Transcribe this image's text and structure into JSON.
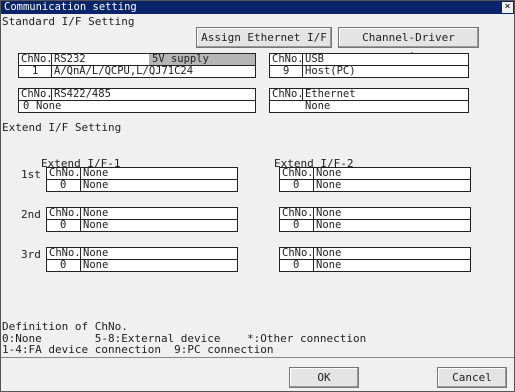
{
  "window": {
    "title": "Communication setting",
    "close_glyph": "×"
  },
  "standard": {
    "heading": "Standard I/F Setting"
  },
  "buttons": {
    "assign_ethernet": "Assign Ethernet I/F",
    "channel_driver": "Channel-Driver assign",
    "ok": "OK",
    "cancel": "Cancel"
  },
  "rs232": {
    "ch_header": "ChNo.",
    "name": "RS232",
    "supply": "5V supply",
    "ch": "1",
    "value": "A/QnA/L/QCPU,L/QJ71C24"
  },
  "usb": {
    "ch_header": "ChNo.",
    "name": "USB",
    "ch": "9",
    "value": "Host(PC)"
  },
  "rs422": {
    "ch_header": "ChNo.",
    "name": "RS422/485",
    "ch": "0",
    "value": "None"
  },
  "ethernet": {
    "ch_header": "ChNo.",
    "name": "Ethernet",
    "value": "None"
  },
  "extend": {
    "heading": "Extend I/F Setting",
    "col1": "Extend I/F-1",
    "col2": "Extend I/F-2",
    "rows": [
      {
        "label": "1st",
        "l_hdr": "ChNo.",
        "l_name": "None",
        "l_ch": "0",
        "l_val": "None",
        "r_hdr": "ChNo.",
        "r_name": "None",
        "r_ch": "0",
        "r_val": "None"
      },
      {
        "label": "2nd",
        "l_hdr": "ChNo.",
        "l_name": "None",
        "l_ch": "0",
        "l_val": "None",
        "r_hdr": "ChNo.",
        "r_name": "None",
        "r_ch": "0",
        "r_val": "None"
      },
      {
        "label": "3rd",
        "l_hdr": "ChNo.",
        "l_name": "None",
        "l_ch": "0",
        "l_val": "None",
        "r_hdr": "ChNo.",
        "r_name": "None",
        "r_ch": "0",
        "r_val": "None"
      }
    ]
  },
  "definition": {
    "title": "Definition of ChNo.",
    "line1": "0:None        5-8:External device    *:Other connection",
    "line2": "1-4:FA device connection  9:PC connection"
  }
}
